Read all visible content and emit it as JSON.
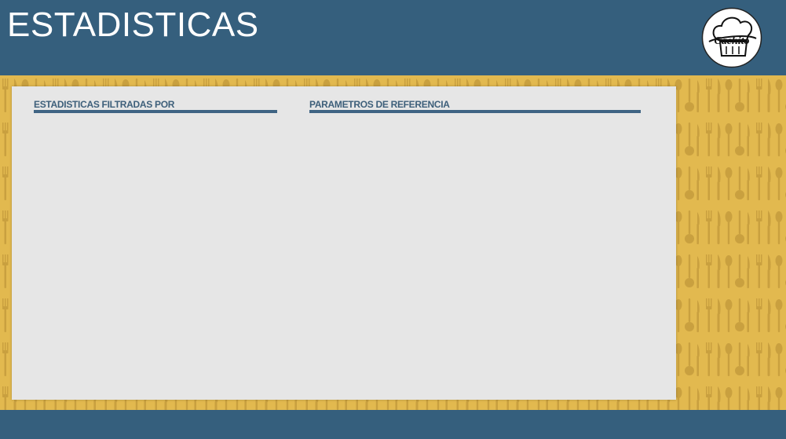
{
  "header": {
    "title": "ESTADISTICAS",
    "logo_text": "Cachito",
    "logo_icon": "chef-hat-icon"
  },
  "panel": {
    "left_section_title": "ESTADISTICAS FILTRADAS POR",
    "right_section_title": "PARAMETROS DE REFERENCIA"
  },
  "colors": {
    "header_bg": "#355f7d",
    "pattern_bg": "#e2b94f",
    "pattern_fg": "#c9a03f",
    "panel_bg": "#e6e6e6",
    "accent_rule": "#3f6484"
  },
  "background_pattern_icon": "cutlery-pattern-icon"
}
